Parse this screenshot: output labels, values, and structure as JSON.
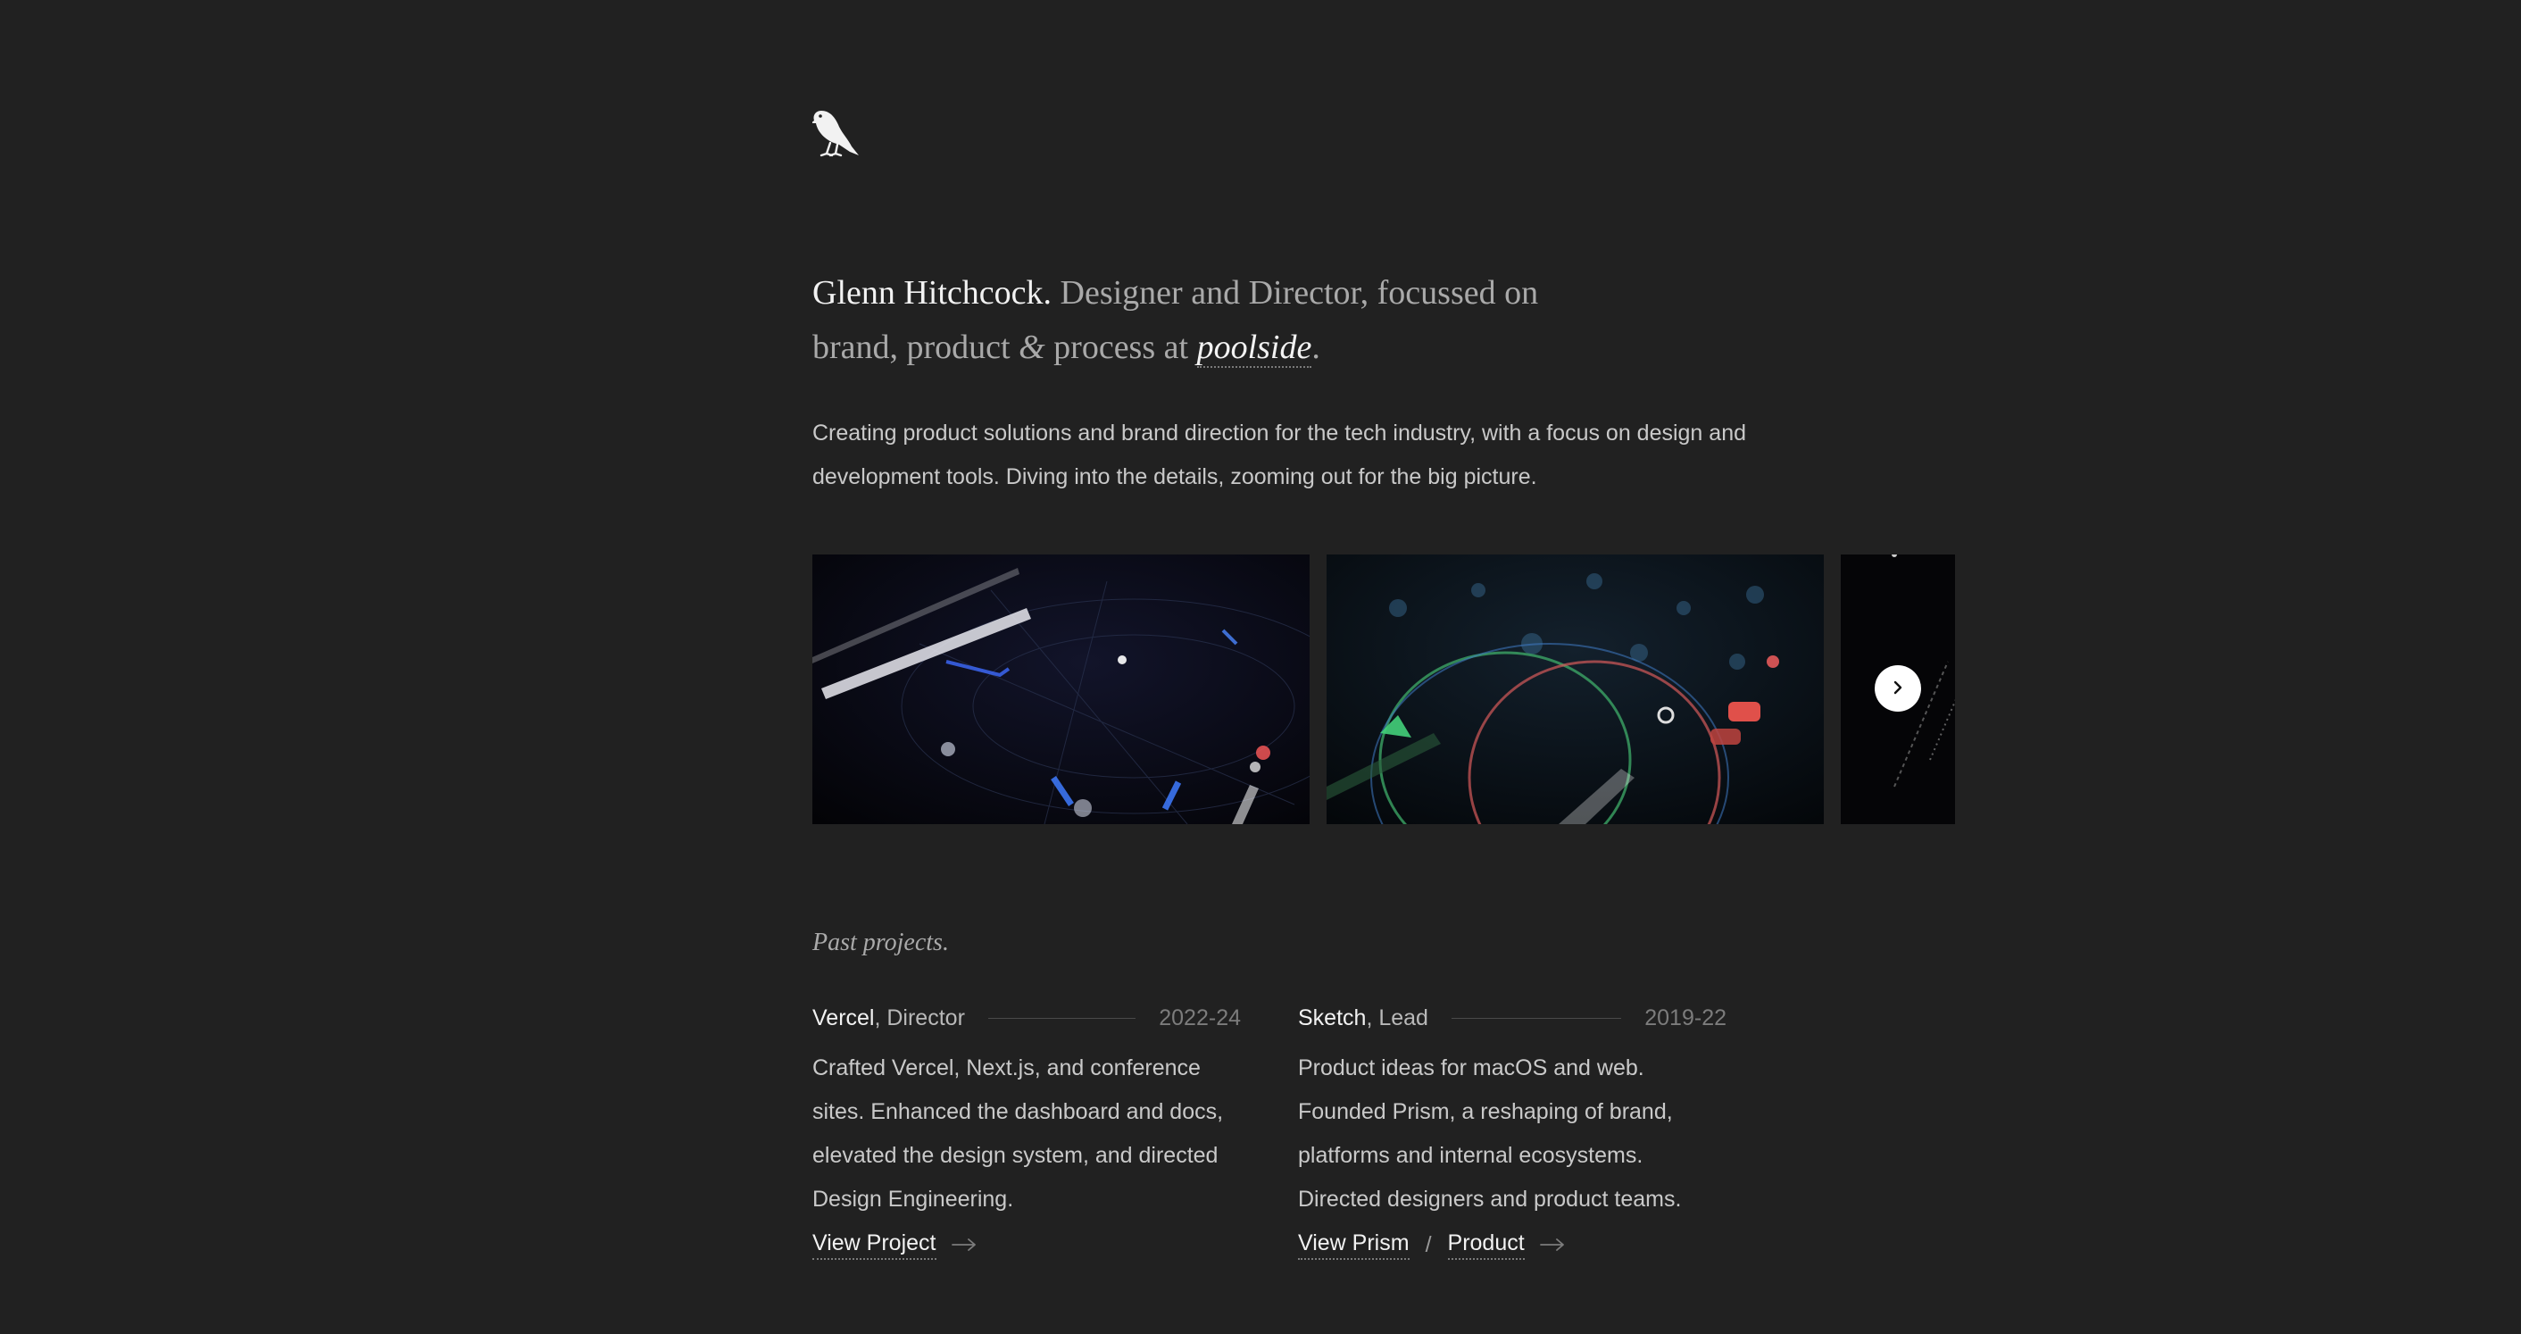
{
  "hero": {
    "name": "Glenn Hitchcock.",
    "tagline_pre": " Designer and Director, focussed on brand, product ",
    "amp": "&",
    "tagline_mid": " process at ",
    "company_link": "poolside",
    "tagline_end": ".",
    "intro": "Creating product solutions and brand direction for the tech industry, with a focus on design and development tools. Diving into the details, zooming out for the big picture."
  },
  "icons": {
    "logo": "bird-logo-icon",
    "carousel_next": "chevron-right-icon",
    "link_arrow": "arrow-right-icon"
  },
  "section": {
    "title": "Past projects."
  },
  "projects": [
    {
      "company": "Vercel",
      "role": ", Director",
      "years": "2022-24",
      "description": "Crafted Vercel, Next.js, and conference sites. Enhanced the dashboard and docs, elevated the design system, and directed Design Engineering.",
      "links": [
        "View Project"
      ]
    },
    {
      "company": "Sketch",
      "role": ", Lead",
      "years": "2019-22",
      "description": "Product ideas for macOS and web. Founded Prism, a reshaping of brand, platforms and internal ecosystems. Directed designers and product teams.",
      "links": [
        "View Prism",
        "Product"
      ],
      "link_separator": "/"
    }
  ],
  "colors": {
    "background": "#212121",
    "text_primary": "#f2f2f2",
    "text_secondary": "#c9c9c9",
    "text_muted": "#7c7c7c"
  }
}
